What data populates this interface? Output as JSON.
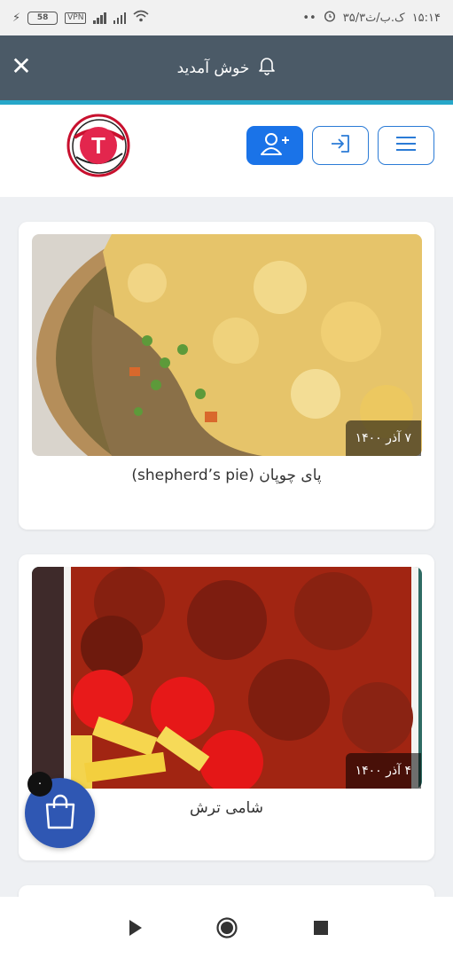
{
  "status_bar": {
    "time": "۱۵:۱۴",
    "date": "۳۵/۳ک.ب/ث",
    "dots": "••",
    "battery": "58",
    "vpn": "VPN"
  },
  "header": {
    "title": "خوش آمدید",
    "close_symbol": "✕",
    "background": "#4b5a67",
    "accent_line": "#27a7c9"
  },
  "toolbar": {
    "logo_letter": "T"
  },
  "cards": [
    {
      "name": "پای چوپان (shepherd’s pie)",
      "date": "۷ آذر ۱۴۰۰"
    },
    {
      "name": "شامی ترش",
      "date": "۴ آذر ۱۴۰۰"
    }
  ],
  "cart": {
    "count": "۰",
    "color": "#2f57b3"
  },
  "nav": {
    "back_icon": "play-icon",
    "home_icon": "circle-icon",
    "recent_icon": "square-icon"
  }
}
